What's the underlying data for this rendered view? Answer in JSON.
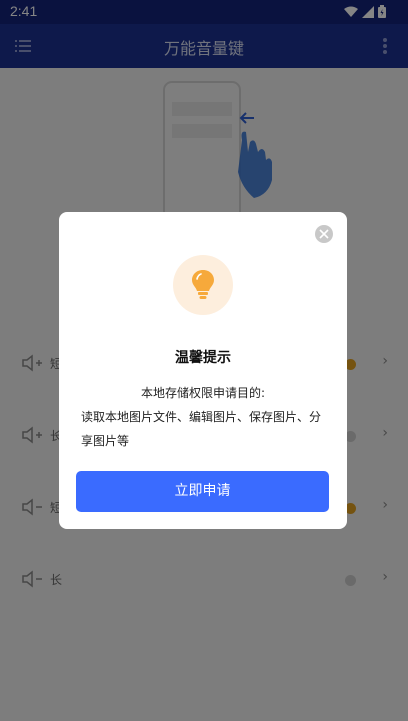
{
  "status_bar": {
    "time": "2:41",
    "icons": [
      "wifi-icon",
      "signal-icon",
      "battery-icon"
    ]
  },
  "app_bar": {
    "title": "万能音量键",
    "left_icon": "menu-icon",
    "right_icon": "more-vert-icon"
  },
  "list": {
    "items": [
      {
        "icon": "volume-up-icon",
        "label": "短",
        "badge_color": "#e0a020"
      },
      {
        "icon": "volume-up-icon",
        "label": "长",
        "badge_color": "#cccccc"
      },
      {
        "icon": "volume-down-icon",
        "label": "短",
        "badge_color": "#e0a020"
      },
      {
        "icon": "volume-down-icon",
        "label": "长",
        "badge_color": "#cccccc"
      }
    ]
  },
  "dialog": {
    "icon": "lightbulb-icon",
    "title": "温馨提示",
    "body_line1": "本地存储权限申请目的:",
    "body_line2": "读取本地图片文件、编辑图片、保存图片、分享图片等",
    "button_label": "立即申请"
  },
  "colors": {
    "app_bar": "#1c3191",
    "primary_button": "#3a6bff",
    "bulb": "#f6a93b"
  }
}
